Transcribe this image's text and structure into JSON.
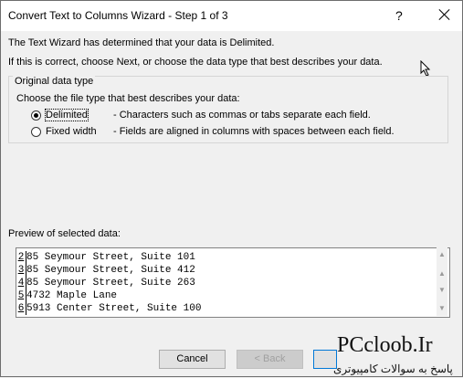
{
  "window": {
    "title": "Convert Text to Columns Wizard - Step 1 of 3",
    "help_label": "?",
    "close_label": ""
  },
  "intro": {
    "line1": "The Text Wizard has determined that your data is Delimited.",
    "line2": "If this is correct, choose Next, or choose the data type that best describes your data."
  },
  "data_type": {
    "legend": "Original data type",
    "prompt": "Choose the file type that best describes your data:",
    "options": [
      {
        "label": "Delimited",
        "desc": "- Characters such as commas or tabs separate each field.",
        "selected": true
      },
      {
        "label": "Fixed width",
        "desc": "- Fields are aligned in columns with spaces between each field.",
        "selected": false
      }
    ]
  },
  "preview": {
    "label": "Preview of selected data:",
    "rows": [
      {
        "num": "2",
        "text": "85 Seymour Street, Suite 101"
      },
      {
        "num": "3",
        "text": "85 Seymour Street, Suite 412"
      },
      {
        "num": "4",
        "text": "85 Seymour Street, Suite 263"
      },
      {
        "num": "5",
        "text": "4732 Maple Lane"
      },
      {
        "num": "6",
        "text": "5913 Center Street, Suite 100"
      }
    ]
  },
  "buttons": {
    "cancel": "Cancel",
    "back": "< Back",
    "next": ""
  },
  "watermark": {
    "brand": "PCcloob.Ir",
    "tagline": "پاسخ به سوالات کامپیوتری"
  }
}
